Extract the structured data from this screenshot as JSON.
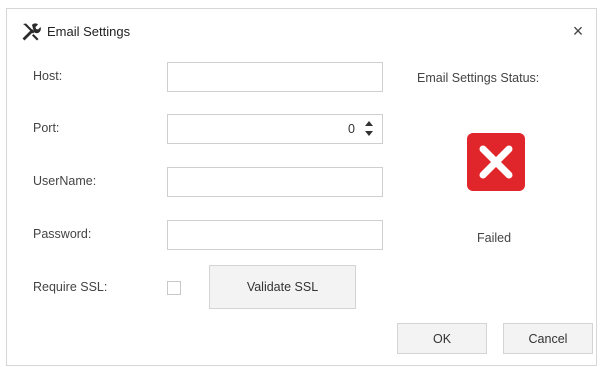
{
  "window": {
    "title": "Email Settings",
    "icon": "tools-icon",
    "close_glyph": "×"
  },
  "form": {
    "host_label": "Host:",
    "host_value": "",
    "port_label": "Port:",
    "port_value": "0",
    "username_label": "UserName:",
    "username_value": "",
    "password_label": "Password:",
    "password_value": "",
    "ssl_label": "Require SSL:",
    "ssl_checked": false
  },
  "buttons": {
    "validate_ssl": "Validate SSL",
    "ok": "OK",
    "cancel": "Cancel"
  },
  "status": {
    "label": "Email Settings Status:",
    "text": "Failed",
    "icon": "failed-x-icon",
    "color": "#e0252b"
  }
}
